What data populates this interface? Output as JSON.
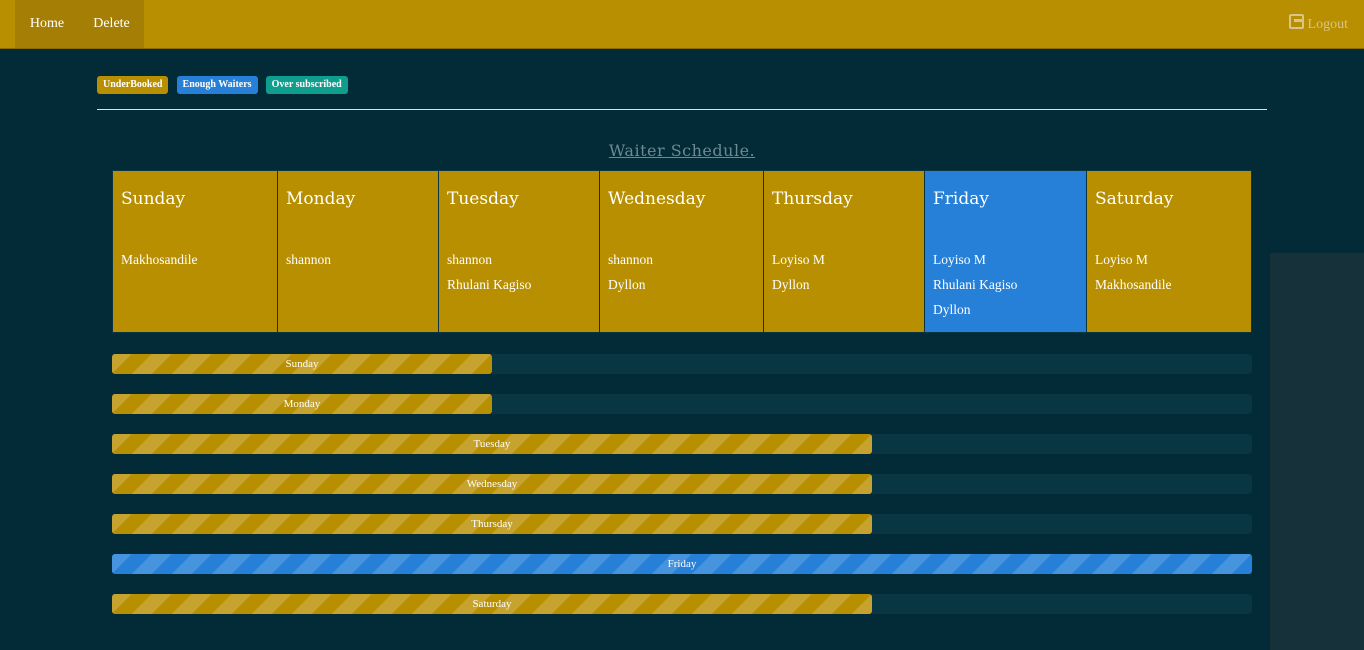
{
  "nav": {
    "home": "Home",
    "delete": "Delete",
    "logout": "Logout"
  },
  "legend": [
    {
      "label": "UnderBooked",
      "color": "#b88f00"
    },
    {
      "label": "Enough Waiters",
      "color": "#2680d8"
    },
    {
      "label": "Over subscribed",
      "color": "#0f9d8e"
    }
  ],
  "schedule_title": "Waiter Schedule.",
  "days": [
    {
      "name": "Sunday",
      "status": "under",
      "waiters": [
        "Makhosandile"
      ]
    },
    {
      "name": "Monday",
      "status": "under",
      "waiters": [
        "shannon"
      ]
    },
    {
      "name": "Tuesday",
      "status": "under",
      "waiters": [
        "shannon",
        "Rhulani Kagiso"
      ]
    },
    {
      "name": "Wednesday",
      "status": "under",
      "waiters": [
        "shannon",
        "Dyllon"
      ]
    },
    {
      "name": "Thursday",
      "status": "under",
      "waiters": [
        "Loyiso M",
        "Dyllon"
      ]
    },
    {
      "name": "Friday",
      "status": "enough",
      "waiters": [
        "Loyiso M",
        "Rhulani Kagiso",
        "Dyllon"
      ]
    },
    {
      "name": "Saturday",
      "status": "under",
      "waiters": [
        "Loyiso M",
        "Makhosandile"
      ]
    }
  ],
  "progress": [
    {
      "label": "Sunday",
      "percent": 33.3,
      "status": "under"
    },
    {
      "label": "Monday",
      "percent": 33.3,
      "status": "under"
    },
    {
      "label": "Tuesday",
      "percent": 66.7,
      "status": "under"
    },
    {
      "label": "Wednesday",
      "percent": 66.7,
      "status": "under"
    },
    {
      "label": "Thursday",
      "percent": 66.7,
      "status": "under"
    },
    {
      "label": "Friday",
      "percent": 100,
      "status": "enough"
    },
    {
      "label": "Saturday",
      "percent": 66.7,
      "status": "under"
    }
  ],
  "colors": {
    "under": "#b88f00",
    "enough": "#2680d8",
    "over": "#0f9d8e"
  }
}
